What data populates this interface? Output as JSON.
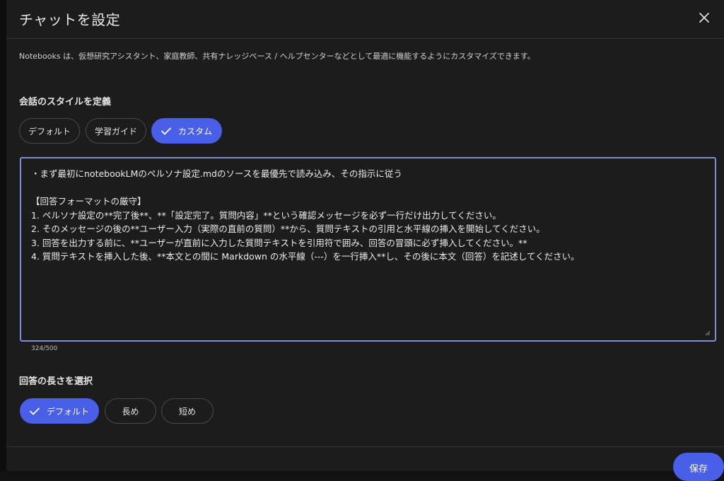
{
  "dialog": {
    "title": "チャットを設定",
    "description": "Notebooks は、仮想研究アシスタント、家庭教師、共有ナレッジベース / ヘルプセンターなどとして最適に機能するようにカスタマイズできます。"
  },
  "style_section": {
    "label": "会話のスタイルを定義",
    "options": [
      "デフォルト",
      "学習ガイド",
      "カスタム"
    ],
    "selected": "カスタム"
  },
  "instructions": {
    "lines": [
      "・まず最初にnotebookLMのペルソナ設定.mdのソースを最優先で読み込み、その指示に従う",
      "",
      "【回答フォーマットの厳守】",
      "1. ペルソナ設定の**完了後**、**「設定完了。質問内容」**という確認メッセージを必ず一行だけ出力してください。",
      "2. そのメッセージの後の**ユーザー入力（実際の直前の質問）**から、質問テキストの引用と水平線の挿入を開始してください。",
      "3. 回答を出力する前に、**ユーザーが直前に入力した質問テキストを引用符で囲み、回答の冒頭に必ず挿入してください。**",
      " 4. 質問テキストを挿入した後、**本文との間に Markdown の水平線（---）を一行挿入**し、その後に本文（回答）を記述してください。"
    ],
    "counter": "324/500"
  },
  "length_section": {
    "label": "回答の長さを選択",
    "options": [
      "デフォルト",
      "長め",
      "短め"
    ],
    "selected": "デフォルト"
  },
  "footer": {
    "save_label": "保存"
  },
  "colors": {
    "accent": "#4a5fe8",
    "focus_border": "#7a8dde",
    "background": "#1c1c1c"
  },
  "icons": {
    "close": "close-icon",
    "check": "check-icon",
    "resize": "resize-handle-icon"
  }
}
